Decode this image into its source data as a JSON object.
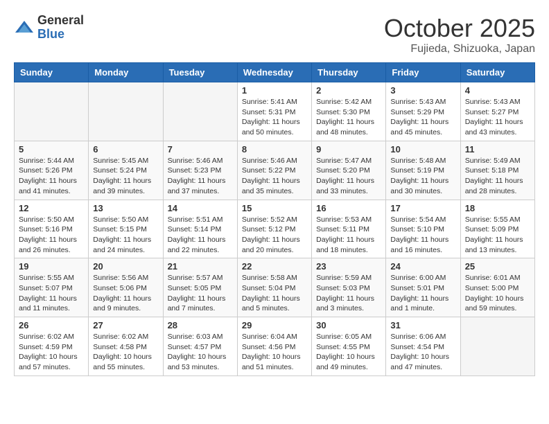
{
  "header": {
    "logo_general": "General",
    "logo_blue": "Blue",
    "month_title": "October 2025",
    "location": "Fujieda, Shizuoka, Japan"
  },
  "weekdays": [
    "Sunday",
    "Monday",
    "Tuesday",
    "Wednesday",
    "Thursday",
    "Friday",
    "Saturday"
  ],
  "weeks": [
    [
      {
        "day": "",
        "info": ""
      },
      {
        "day": "",
        "info": ""
      },
      {
        "day": "",
        "info": ""
      },
      {
        "day": "1",
        "info": "Sunrise: 5:41 AM\nSunset: 5:31 PM\nDaylight: 11 hours\nand 50 minutes."
      },
      {
        "day": "2",
        "info": "Sunrise: 5:42 AM\nSunset: 5:30 PM\nDaylight: 11 hours\nand 48 minutes."
      },
      {
        "day": "3",
        "info": "Sunrise: 5:43 AM\nSunset: 5:29 PM\nDaylight: 11 hours\nand 45 minutes."
      },
      {
        "day": "4",
        "info": "Sunrise: 5:43 AM\nSunset: 5:27 PM\nDaylight: 11 hours\nand 43 minutes."
      }
    ],
    [
      {
        "day": "5",
        "info": "Sunrise: 5:44 AM\nSunset: 5:26 PM\nDaylight: 11 hours\nand 41 minutes."
      },
      {
        "day": "6",
        "info": "Sunrise: 5:45 AM\nSunset: 5:24 PM\nDaylight: 11 hours\nand 39 minutes."
      },
      {
        "day": "7",
        "info": "Sunrise: 5:46 AM\nSunset: 5:23 PM\nDaylight: 11 hours\nand 37 minutes."
      },
      {
        "day": "8",
        "info": "Sunrise: 5:46 AM\nSunset: 5:22 PM\nDaylight: 11 hours\nand 35 minutes."
      },
      {
        "day": "9",
        "info": "Sunrise: 5:47 AM\nSunset: 5:20 PM\nDaylight: 11 hours\nand 33 minutes."
      },
      {
        "day": "10",
        "info": "Sunrise: 5:48 AM\nSunset: 5:19 PM\nDaylight: 11 hours\nand 30 minutes."
      },
      {
        "day": "11",
        "info": "Sunrise: 5:49 AM\nSunset: 5:18 PM\nDaylight: 11 hours\nand 28 minutes."
      }
    ],
    [
      {
        "day": "12",
        "info": "Sunrise: 5:50 AM\nSunset: 5:16 PM\nDaylight: 11 hours\nand 26 minutes."
      },
      {
        "day": "13",
        "info": "Sunrise: 5:50 AM\nSunset: 5:15 PM\nDaylight: 11 hours\nand 24 minutes."
      },
      {
        "day": "14",
        "info": "Sunrise: 5:51 AM\nSunset: 5:14 PM\nDaylight: 11 hours\nand 22 minutes."
      },
      {
        "day": "15",
        "info": "Sunrise: 5:52 AM\nSunset: 5:12 PM\nDaylight: 11 hours\nand 20 minutes."
      },
      {
        "day": "16",
        "info": "Sunrise: 5:53 AM\nSunset: 5:11 PM\nDaylight: 11 hours\nand 18 minutes."
      },
      {
        "day": "17",
        "info": "Sunrise: 5:54 AM\nSunset: 5:10 PM\nDaylight: 11 hours\nand 16 minutes."
      },
      {
        "day": "18",
        "info": "Sunrise: 5:55 AM\nSunset: 5:09 PM\nDaylight: 11 hours\nand 13 minutes."
      }
    ],
    [
      {
        "day": "19",
        "info": "Sunrise: 5:55 AM\nSunset: 5:07 PM\nDaylight: 11 hours\nand 11 minutes."
      },
      {
        "day": "20",
        "info": "Sunrise: 5:56 AM\nSunset: 5:06 PM\nDaylight: 11 hours\nand 9 minutes."
      },
      {
        "day": "21",
        "info": "Sunrise: 5:57 AM\nSunset: 5:05 PM\nDaylight: 11 hours\nand 7 minutes."
      },
      {
        "day": "22",
        "info": "Sunrise: 5:58 AM\nSunset: 5:04 PM\nDaylight: 11 hours\nand 5 minutes."
      },
      {
        "day": "23",
        "info": "Sunrise: 5:59 AM\nSunset: 5:03 PM\nDaylight: 11 hours\nand 3 minutes."
      },
      {
        "day": "24",
        "info": "Sunrise: 6:00 AM\nSunset: 5:01 PM\nDaylight: 11 hours\nand 1 minute."
      },
      {
        "day": "25",
        "info": "Sunrise: 6:01 AM\nSunset: 5:00 PM\nDaylight: 10 hours\nand 59 minutes."
      }
    ],
    [
      {
        "day": "26",
        "info": "Sunrise: 6:02 AM\nSunset: 4:59 PM\nDaylight: 10 hours\nand 57 minutes."
      },
      {
        "day": "27",
        "info": "Sunrise: 6:02 AM\nSunset: 4:58 PM\nDaylight: 10 hours\nand 55 minutes."
      },
      {
        "day": "28",
        "info": "Sunrise: 6:03 AM\nSunset: 4:57 PM\nDaylight: 10 hours\nand 53 minutes."
      },
      {
        "day": "29",
        "info": "Sunrise: 6:04 AM\nSunset: 4:56 PM\nDaylight: 10 hours\nand 51 minutes."
      },
      {
        "day": "30",
        "info": "Sunrise: 6:05 AM\nSunset: 4:55 PM\nDaylight: 10 hours\nand 49 minutes."
      },
      {
        "day": "31",
        "info": "Sunrise: 6:06 AM\nSunset: 4:54 PM\nDaylight: 10 hours\nand 47 minutes."
      },
      {
        "day": "",
        "info": ""
      }
    ]
  ]
}
